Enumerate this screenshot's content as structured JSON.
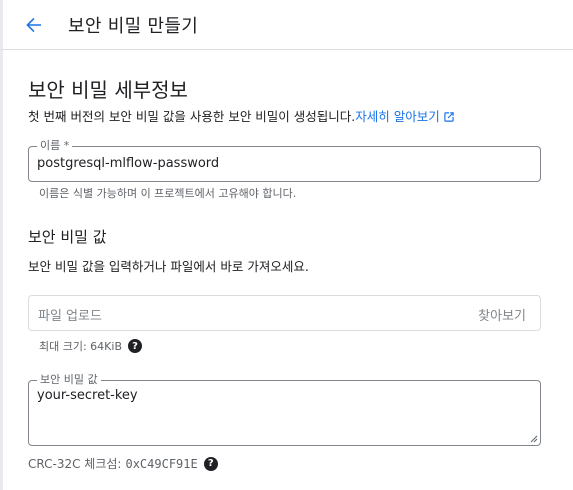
{
  "header": {
    "title": "보안 비밀 만들기",
    "back_icon": "arrow-left-icon"
  },
  "details": {
    "title": "보안 비밀 세부정보",
    "description": "첫 번째 버전의 보안 비밀 값을 사용한 보안 비밀이 생성됩니다.",
    "learn_more": "자세히 알아보기",
    "link_color": "#1a73e8"
  },
  "name_field": {
    "label": "이름 *",
    "value": "postgresql-mlflow-password",
    "hint": "이름은 식별 가능하며 이 프로젝트에서 고유해야 합니다."
  },
  "secret_value": {
    "title": "보안 비밀 값",
    "description": "보안 비밀 값을 입력하거나 파일에서 바로 가져오세요.",
    "upload_placeholder": "파일 업로드",
    "browse_label": "찾아보기",
    "max_size": "최대 크기: 64KiB",
    "value_label": "보안 비밀 값",
    "value": "your-secret-key",
    "checksum_label": "CRC-32C 체크섬:",
    "checksum_value": "0xC49CF91E"
  }
}
